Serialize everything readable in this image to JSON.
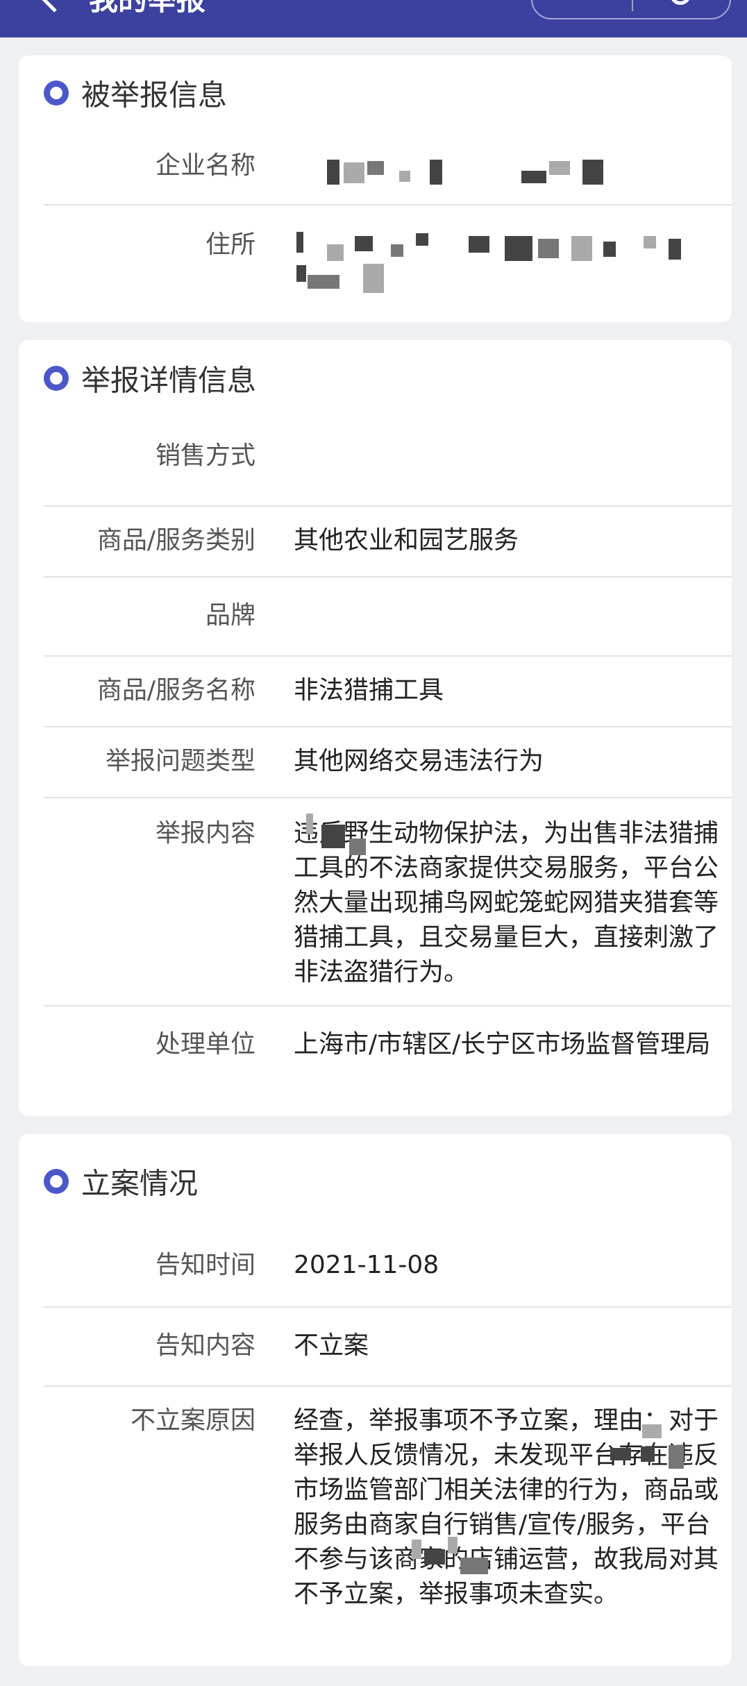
{
  "header": {
    "title": "我的举报"
  },
  "reported_info": {
    "title": "被举报信息",
    "rows": [
      {
        "label": "企业名称",
        "value": ""
      },
      {
        "label": "住所",
        "value": ""
      }
    ]
  },
  "report_details": {
    "title": "举报详情信息",
    "rows": [
      {
        "label": "销售方式",
        "value": ""
      },
      {
        "label": "商品/服务类别",
        "value": "其他农业和园艺服务"
      },
      {
        "label": "品牌",
        "value": ""
      },
      {
        "label": "商品/服务名称",
        "value": "非法猎捕工具"
      },
      {
        "label": "举报问题类型",
        "value": "其他网络交易违法行为"
      },
      {
        "label": "举报内容",
        "value": "违反野生动物保护法，为出售非法猎捕工具的不法商家提供交易服务，平台公然大量出现捕鸟网蛇笼蛇网猎夹猎套等猎捕工具，且交易量巨大，直接刺激了非法盗猎行为。"
      },
      {
        "label": "处理单位",
        "value": "上海市/市辖区/长宁区市场监督管理局"
      }
    ]
  },
  "case_status": {
    "title": "立案情况",
    "rows": [
      {
        "label": "告知时间",
        "value": "2021-11-08"
      },
      {
        "label": "告知内容",
        "value": "不立案"
      },
      {
        "label": "不立案原因",
        "value": "经查，举报事项不予立案，理由：对于举报人反馈情况，未发现平台存在违反市场监管部门相关法律的行为，商品或服务由商家自行销售/宣传/服务，平台不参与该商家的店铺运营，故我局对其不予立案，举报事项未查实。"
      }
    ]
  },
  "colors": {
    "header_bg": "#3c41a0",
    "accent": "#4c58c9",
    "page_bg": "#eff0f4"
  }
}
